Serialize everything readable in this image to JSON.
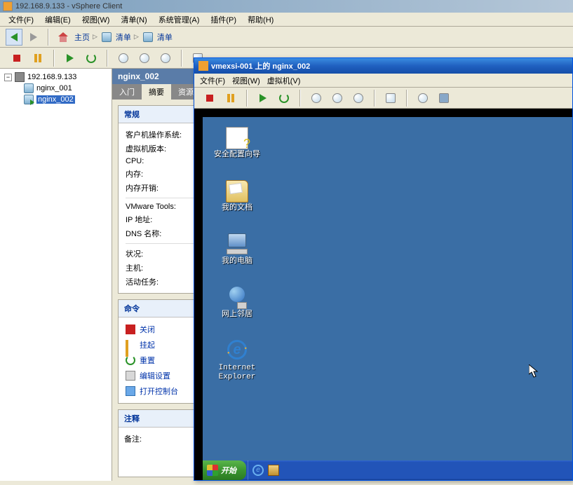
{
  "titlebar": {
    "text": "192.168.9.133 - vSphere Client"
  },
  "menubar": {
    "file": "文件(F)",
    "edit": "编辑(E)",
    "view": "视图(W)",
    "inventory": "清单(N)",
    "admin": "系统管理(A)",
    "plugins": "插件(P)",
    "help": "帮助(H)"
  },
  "nav": {
    "home": "主页",
    "inv1": "清单",
    "inv2": "清单"
  },
  "tree": {
    "root": "192.168.9.133",
    "vms": [
      "nginx_001",
      "nginx_002"
    ]
  },
  "detail": {
    "title": "nginx_002",
    "tabs": {
      "intro": "入门",
      "summary": "摘要",
      "resource": "资源"
    },
    "general": {
      "header": "常规",
      "guest_os": "客户机操作系统:",
      "vm_version": "虚拟机版本:",
      "cpu": "CPU:",
      "memory": "内存:",
      "mem_overhead": "内存开销:",
      "vmtools": "VMware Tools:",
      "ip": "IP 地址:",
      "dns": "DNS 名称:",
      "status": "状况:",
      "host": "主机:",
      "tasks": "活动任务:"
    },
    "commands": {
      "header": "命令",
      "shutdown": "关闭",
      "suspend": "挂起",
      "reset": "重置",
      "edit": "编辑设置",
      "console": "打开控制台"
    },
    "notes": {
      "header": "注释",
      "label": "备注:"
    }
  },
  "console": {
    "title": "vmexsi-001 上的 nginx_002",
    "menu": {
      "file": "文件(F)",
      "view": "视图(W)",
      "vm": "虚拟机(V)"
    },
    "icons": {
      "security": "安全配置向导",
      "documents": "我的文档",
      "computer": "我的电脑",
      "network": "网上邻居",
      "ie": "Internet Explorer"
    },
    "start": "开始"
  }
}
